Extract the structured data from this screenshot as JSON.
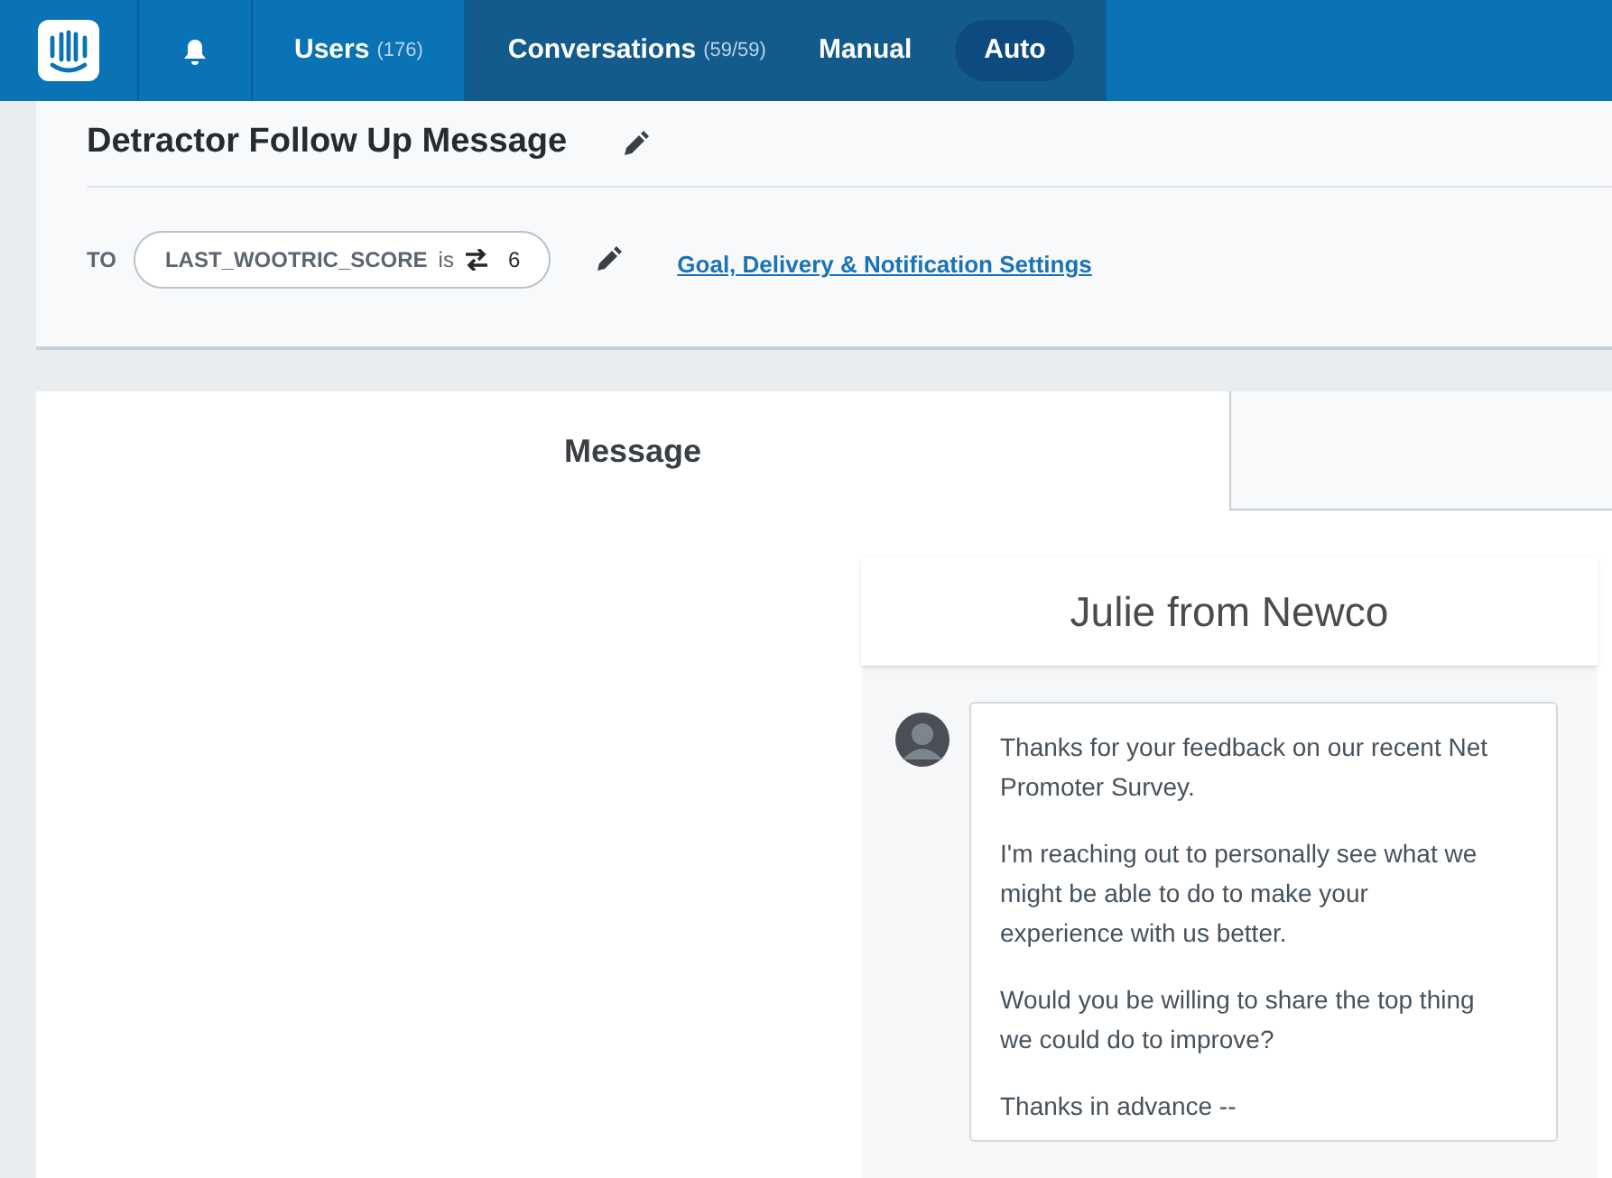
{
  "nav": {
    "items": [
      {
        "kind": "bell",
        "selected": false
      },
      {
        "kind": "link",
        "label": "Users",
        "count": "(176)",
        "selected": false
      },
      {
        "kind": "link",
        "label": "Conversations",
        "count": "(59/59)",
        "selected": true
      }
    ],
    "modes": [
      {
        "label": "Manual",
        "selected": false
      },
      {
        "label": "Auto",
        "selected": true
      }
    ]
  },
  "header": {
    "title": "Detractor Follow Up Message",
    "to_label": "TO",
    "filter": {
      "attribute": "LAST_WOOTRIC_SCORE",
      "operator": "is",
      "value": "6"
    },
    "settings_link": "Goal, Delivery & Notification Settings"
  },
  "tabs": [
    {
      "label": "Message",
      "selected": true
    }
  ],
  "preview": {
    "sender": "Julie from Newco",
    "paragraphs": [
      "Thanks for your feedback on our recent Net Promoter Survey.",
      "I'm reaching out to personally see what we might be able to do to make your experience with us better.",
      "Would you be willing to share the top thing we could do to improve?",
      "Thanks in advance --"
    ]
  }
}
